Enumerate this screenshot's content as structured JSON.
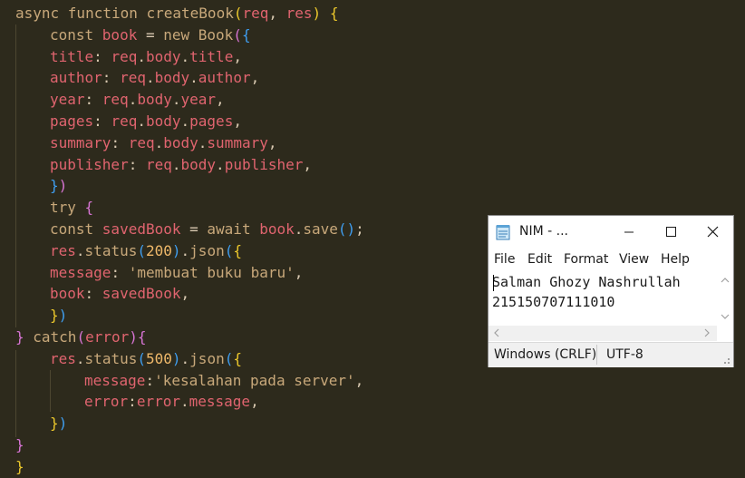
{
  "editor": {
    "lines": [
      {
        "indent": 0,
        "tokens": [
          [
            "kw",
            "async "
          ],
          [
            "kw",
            "function "
          ],
          [
            "fn",
            "createBook"
          ],
          [
            "br1",
            "("
          ],
          [
            "var",
            "req"
          ],
          [
            "pl",
            ", "
          ],
          [
            "var",
            "res"
          ],
          [
            "br1",
            ")"
          ],
          [
            "pl",
            " "
          ],
          [
            "br1",
            "{"
          ]
        ]
      },
      {
        "indent": 1,
        "tokens": [
          [
            "kw",
            "const "
          ],
          [
            "var",
            "book"
          ],
          [
            "op",
            " = "
          ],
          [
            "kw",
            "new "
          ],
          [
            "fn",
            "Book"
          ],
          [
            "br2",
            "("
          ],
          [
            "br3",
            "{"
          ]
        ]
      },
      {
        "indent": 1,
        "tokens": [
          [
            "prop",
            "title"
          ],
          [
            "op",
            ": "
          ],
          [
            "var",
            "req"
          ],
          [
            "op",
            "."
          ],
          [
            "prop",
            "body"
          ],
          [
            "op",
            "."
          ],
          [
            "prop",
            "title"
          ],
          [
            "op",
            ","
          ]
        ]
      },
      {
        "indent": 1,
        "tokens": [
          [
            "prop",
            "author"
          ],
          [
            "op",
            ": "
          ],
          [
            "var",
            "req"
          ],
          [
            "op",
            "."
          ],
          [
            "prop",
            "body"
          ],
          [
            "op",
            "."
          ],
          [
            "prop",
            "author"
          ],
          [
            "op",
            ","
          ]
        ]
      },
      {
        "indent": 1,
        "tokens": [
          [
            "prop",
            "year"
          ],
          [
            "op",
            ": "
          ],
          [
            "var",
            "req"
          ],
          [
            "op",
            "."
          ],
          [
            "prop",
            "body"
          ],
          [
            "op",
            "."
          ],
          [
            "prop",
            "year"
          ],
          [
            "op",
            ","
          ]
        ]
      },
      {
        "indent": 1,
        "tokens": [
          [
            "prop",
            "pages"
          ],
          [
            "op",
            ": "
          ],
          [
            "var",
            "req"
          ],
          [
            "op",
            "."
          ],
          [
            "prop",
            "body"
          ],
          [
            "op",
            "."
          ],
          [
            "prop",
            "pages"
          ],
          [
            "op",
            ","
          ]
        ]
      },
      {
        "indent": 1,
        "tokens": [
          [
            "prop",
            "summary"
          ],
          [
            "op",
            ": "
          ],
          [
            "var",
            "req"
          ],
          [
            "op",
            "."
          ],
          [
            "prop",
            "body"
          ],
          [
            "op",
            "."
          ],
          [
            "prop",
            "summary"
          ],
          [
            "op",
            ","
          ]
        ]
      },
      {
        "indent": 1,
        "tokens": [
          [
            "prop",
            "publisher"
          ],
          [
            "op",
            ": "
          ],
          [
            "var",
            "req"
          ],
          [
            "op",
            "."
          ],
          [
            "prop",
            "body"
          ],
          [
            "op",
            "."
          ],
          [
            "prop",
            "publisher"
          ],
          [
            "op",
            ","
          ]
        ]
      },
      {
        "indent": 1,
        "tokens": [
          [
            "br3",
            "}"
          ],
          [
            "br2",
            ")"
          ]
        ]
      },
      {
        "indent": 1,
        "tokens": [
          [
            "kw",
            "try "
          ],
          [
            "br2",
            "{"
          ]
        ]
      },
      {
        "indent": 1,
        "tokens": [
          [
            "kw",
            "const "
          ],
          [
            "var",
            "savedBook"
          ],
          [
            "op",
            " = "
          ],
          [
            "kw",
            "await "
          ],
          [
            "var",
            "book"
          ],
          [
            "op",
            "."
          ],
          [
            "fn",
            "save"
          ],
          [
            "br3",
            "()"
          ],
          [
            "op",
            ";"
          ]
        ]
      },
      {
        "indent": 1,
        "tokens": [
          [
            "var",
            "res"
          ],
          [
            "op",
            "."
          ],
          [
            "fn",
            "status"
          ],
          [
            "br3",
            "("
          ],
          [
            "num",
            "200"
          ],
          [
            "br3",
            ")"
          ],
          [
            "op",
            "."
          ],
          [
            "fn",
            "json"
          ],
          [
            "br3",
            "("
          ],
          [
            "br1",
            "{"
          ]
        ]
      },
      {
        "indent": 1,
        "tokens": [
          [
            "prop",
            "message"
          ],
          [
            "op",
            ": "
          ],
          [
            "str",
            "'membuat buku baru'"
          ],
          [
            "op",
            ","
          ]
        ]
      },
      {
        "indent": 1,
        "tokens": [
          [
            "prop",
            "book"
          ],
          [
            "op",
            ": "
          ],
          [
            "var",
            "savedBook"
          ],
          [
            "op",
            ","
          ]
        ]
      },
      {
        "indent": 1,
        "tokens": [
          [
            "br1",
            "}"
          ],
          [
            "br3",
            ")"
          ]
        ]
      },
      {
        "indent": 0,
        "tokens": [
          [
            "br2",
            "}"
          ],
          [
            "kw",
            " catch"
          ],
          [
            "br2",
            "("
          ],
          [
            "var",
            "error"
          ],
          [
            "br2",
            ")"
          ],
          [
            "br2",
            "{"
          ]
        ]
      },
      {
        "indent": 1,
        "tokens": [
          [
            "var",
            "res"
          ],
          [
            "op",
            "."
          ],
          [
            "fn",
            "status"
          ],
          [
            "br3",
            "("
          ],
          [
            "num",
            "500"
          ],
          [
            "br3",
            ")"
          ],
          [
            "op",
            "."
          ],
          [
            "fn",
            "json"
          ],
          [
            "br3",
            "("
          ],
          [
            "br1",
            "{"
          ]
        ]
      },
      {
        "indent": 2,
        "tokens": [
          [
            "prop",
            "message"
          ],
          [
            "op",
            ":"
          ],
          [
            "str",
            "'kesalahan pada server'"
          ],
          [
            "op",
            ","
          ]
        ]
      },
      {
        "indent": 2,
        "tokens": [
          [
            "prop",
            "error"
          ],
          [
            "op",
            ":"
          ],
          [
            "var",
            "error"
          ],
          [
            "op",
            "."
          ],
          [
            "prop",
            "message"
          ],
          [
            "op",
            ","
          ]
        ]
      },
      {
        "indent": 1,
        "tokens": [
          [
            "br1",
            "}"
          ],
          [
            "br3",
            ")"
          ]
        ]
      },
      {
        "indent": 0,
        "tokens": [
          [
            "br2",
            "}"
          ]
        ]
      },
      {
        "indent": 0,
        "tokens": [
          [
            "br1",
            "}"
          ]
        ]
      }
    ]
  },
  "notepad": {
    "title": "NIM - ...",
    "menu": [
      "File",
      "Edit",
      "Format",
      "View",
      "Help"
    ],
    "content_lines": [
      "Salman Ghozy Nashrullah",
      "215150707111010"
    ],
    "status": {
      "line_ending": "Windows (CRLF)",
      "encoding": "UTF-8"
    }
  }
}
